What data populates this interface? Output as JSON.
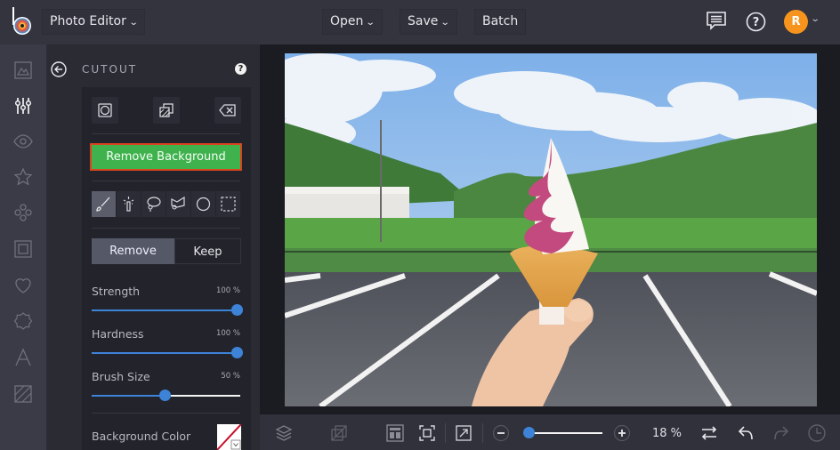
{
  "app": {
    "title": "Photo Editor"
  },
  "topbar": {
    "app_menu_label": "Photo Editor",
    "open_label": "Open",
    "save_label": "Save",
    "batch_label": "Batch",
    "feedback_icon": "chat-icon",
    "help_icon": "help-icon",
    "avatar_initial": "R",
    "avatar_color": "#f7941d"
  },
  "leftbar": {
    "items": [
      {
        "name": "image",
        "icon": "image-icon"
      },
      {
        "name": "adjustments",
        "icon": "sliders-icon",
        "active": true
      },
      {
        "name": "effects",
        "icon": "eye-icon"
      },
      {
        "name": "touch-up",
        "icon": "star-icon"
      },
      {
        "name": "graphics",
        "icon": "circles-icon"
      },
      {
        "name": "frames",
        "icon": "frame-icon"
      },
      {
        "name": "overlays",
        "icon": "heart-icon"
      },
      {
        "name": "stickers",
        "icon": "badge-icon"
      },
      {
        "name": "text",
        "icon": "text-icon"
      },
      {
        "name": "textures",
        "icon": "texture-icon"
      }
    ]
  },
  "panel": {
    "title": "CUTOUT",
    "help": "?",
    "top_buttons": [
      "circle-crop-icon",
      "layers-swap-icon",
      "clear-icon"
    ],
    "remove_bg_label": "Remove Background",
    "remove_bg_color": "#3fb24e",
    "tools": [
      "brush-icon",
      "magic-wand-icon",
      "lasso-icon",
      "polygon-lasso-icon",
      "ellipse-select-icon",
      "rect-select-icon"
    ],
    "active_tool": "brush-icon",
    "mode": {
      "remove_label": "Remove",
      "keep_label": "Keep",
      "selected": "Remove"
    },
    "sliders": [
      {
        "label": "Strength",
        "value_text": "100 %",
        "value": 100
      },
      {
        "label": "Hardness",
        "value_text": "100 %",
        "value": 100
      },
      {
        "label": "Brush Size",
        "value_text": "50 %",
        "value": 50
      }
    ],
    "bg_color_label": "Background Color",
    "bg_color_value": "transparent"
  },
  "bottombar": {
    "zoom_value_text": "18 %",
    "zoom_value": 18,
    "icons": [
      "layers-icon",
      "crop-compare-icon",
      "layout-icon",
      "fit-screen-icon",
      "expand-icon",
      "zoom-out-icon",
      "zoom-in-icon",
      "swap-icon",
      "undo-icon",
      "redo-icon",
      "history-icon"
    ]
  },
  "canvas": {
    "subject": "soft-serve ice cream cone held over parking lot with green hills"
  }
}
